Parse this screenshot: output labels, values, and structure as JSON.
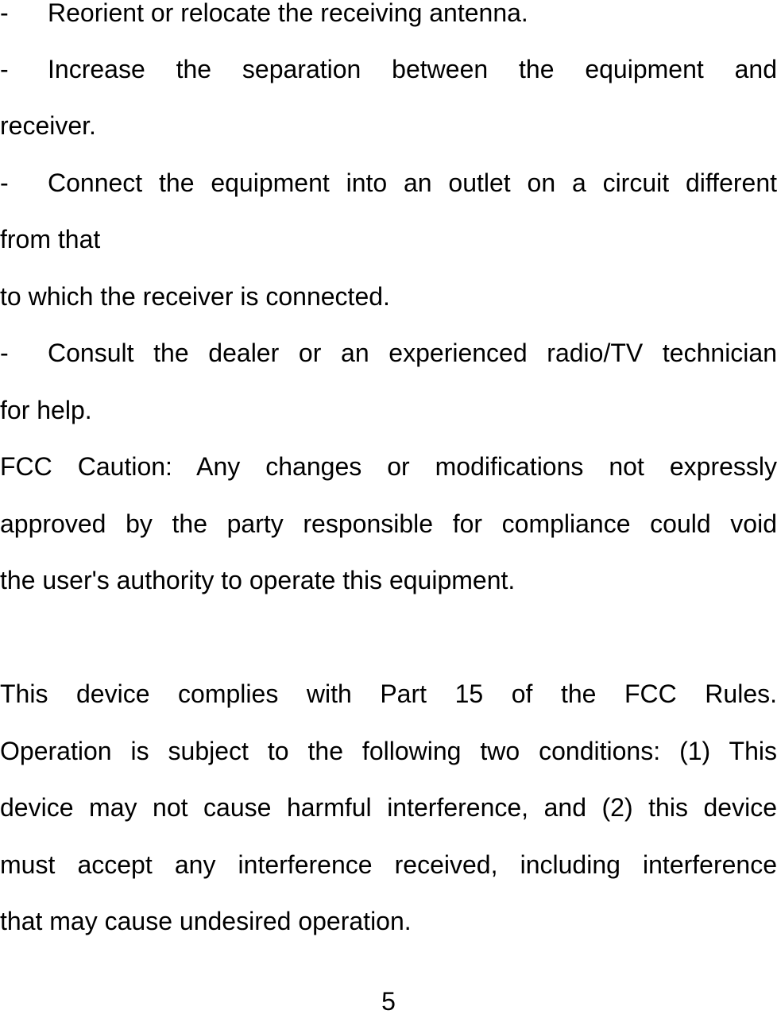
{
  "bullets": [
    {
      "dash": "-",
      "first_line": "Reorient or relocate the receiving antenna.",
      "continuation": []
    },
    {
      "dash": "-",
      "first_line": "Increase the separation between the equipment and",
      "continuation": [
        "receiver."
      ]
    },
    {
      "dash": "-",
      "first_line": "Connect the equipment into an outlet on a circuit different",
      "continuation": [
        "from that",
        "to which the receiver is connected."
      ]
    },
    {
      "dash": "-",
      "first_line": "Consult the dealer or an experienced radio/TV technician",
      "continuation": [
        "for help."
      ]
    }
  ],
  "fcc_caution": {
    "lines": [
      "FCC Caution: Any changes or modifications not expressly",
      "approved by the party responsible for compliance could void",
      "the user's authority to operate this equipment."
    ]
  },
  "compliance": {
    "lines": [
      "This device complies with Part 15 of the FCC Rules.",
      "Operation is subject to the following two conditions: (1) This",
      "device may not cause harmful interference, and (2) this device",
      "must accept any interference received, including interference",
      "that may cause undesired operation."
    ]
  },
  "page_number": "5"
}
